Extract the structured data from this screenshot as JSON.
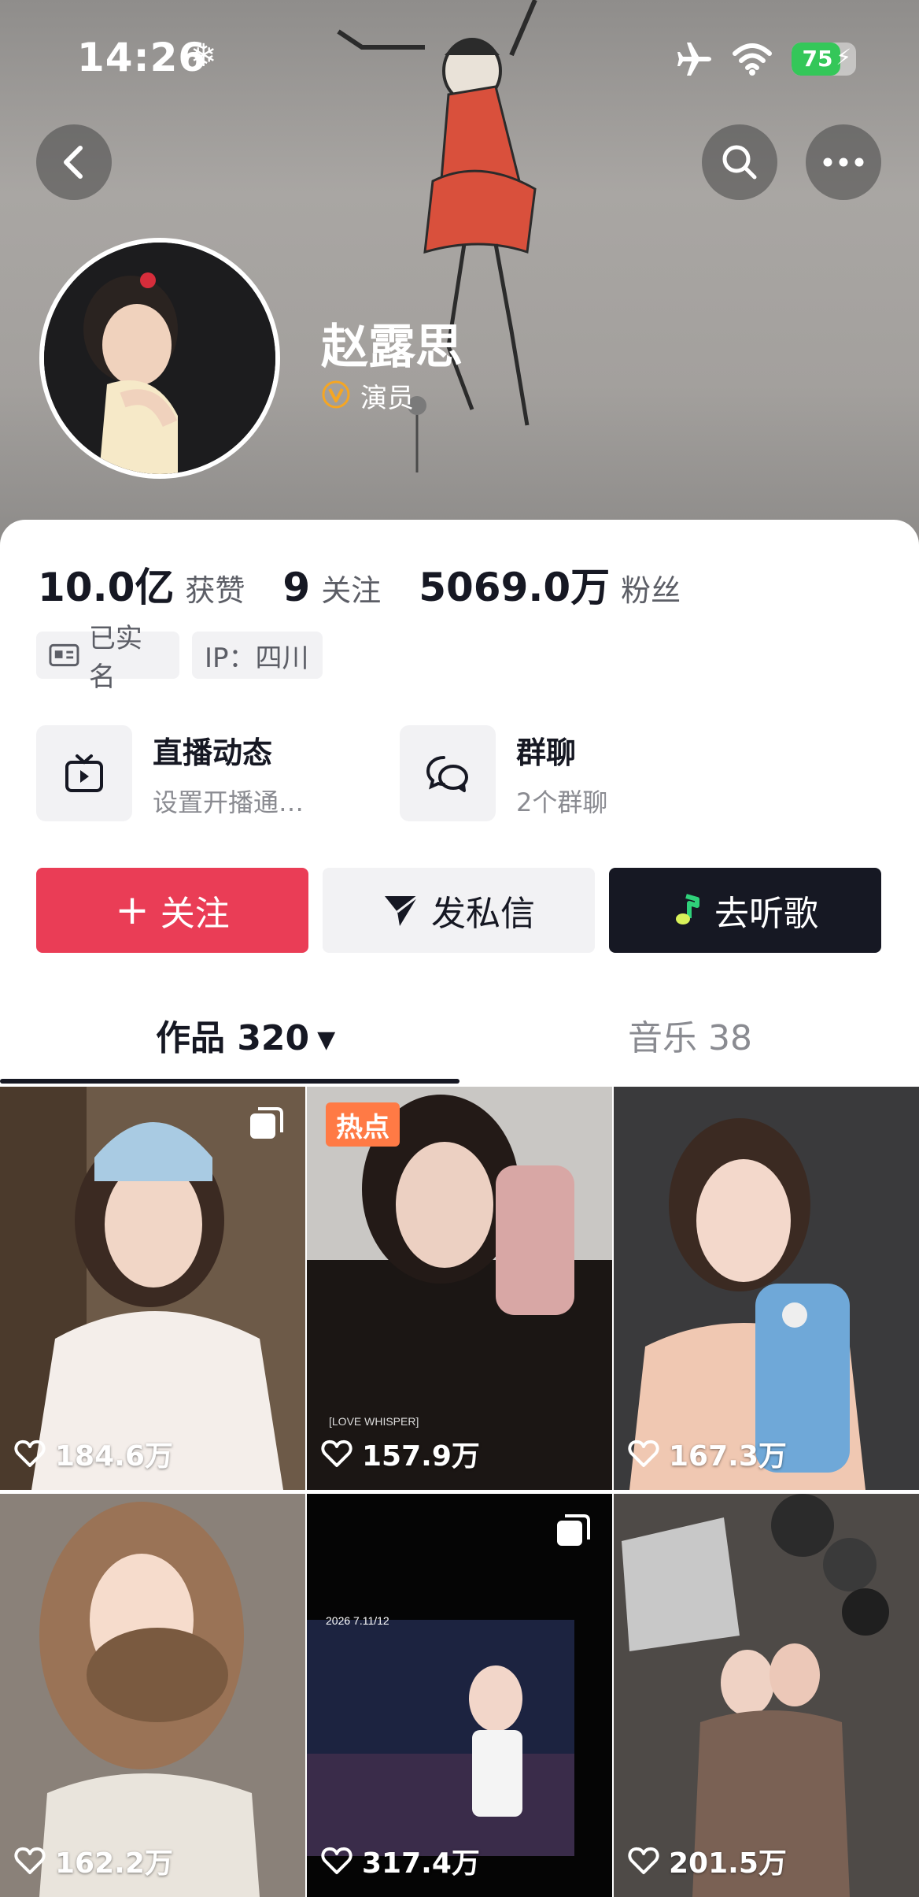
{
  "status_bar": {
    "time": "14:26",
    "snow_glyph": "❄",
    "battery_percent": "75",
    "battery_level": 0.75
  },
  "profile": {
    "name": "赵露思",
    "role": "演员",
    "verified_color": "#f5a623"
  },
  "stats": [
    {
      "value": "10.0亿",
      "label": "获赞"
    },
    {
      "value": "9",
      "label": "关注"
    },
    {
      "value": "5069.0万",
      "label": "粉丝"
    }
  ],
  "tags": {
    "realname": "已实名",
    "ip": "IP：四川"
  },
  "features": {
    "live": {
      "title": "直播动态",
      "subtitle": "设置开播通…"
    },
    "group": {
      "title": "群聊",
      "subtitle": "2个群聊"
    }
  },
  "actions": {
    "follow": "关注",
    "follow_prefix": "+",
    "message": "发私信",
    "music": "去听歌"
  },
  "tabs": {
    "works": "作品 320",
    "works_caret": "▼",
    "music": "音乐 38"
  },
  "videos": [
    {
      "likes": "184.6万",
      "multi": true,
      "hot": ""
    },
    {
      "likes": "157.9万",
      "multi": false,
      "hot": "热点"
    },
    {
      "likes": "167.3万",
      "multi": false,
      "hot": ""
    },
    {
      "likes": "162.2万",
      "multi": false,
      "hot": ""
    },
    {
      "likes": "317.4万",
      "multi": true,
      "hot": ""
    },
    {
      "likes": "201.5万",
      "multi": false,
      "hot": ""
    }
  ],
  "colors": {
    "follow": "#ea3d56",
    "dark": "#161823",
    "hot": "#ff7a45"
  }
}
